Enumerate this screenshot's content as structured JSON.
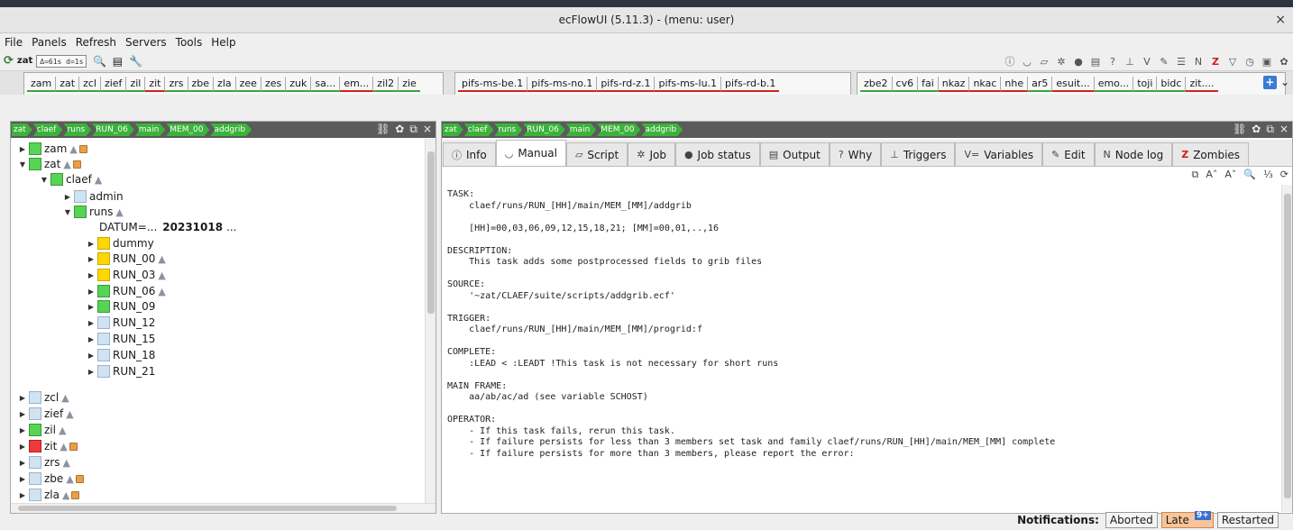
{
  "window": {
    "title": "ecFlowUI (5.11.3) - (menu: user)",
    "close": "×"
  },
  "menu": [
    "File",
    "Panels",
    "Refresh",
    "Servers",
    "Tools",
    "Help"
  ],
  "toolbar": {
    "server": "zat",
    "interval": "Δ=61s d=1s"
  },
  "server_tabs": {
    "group1": [
      {
        "label": "zam",
        "status": "green"
      },
      {
        "label": "zat",
        "status": "green"
      },
      {
        "label": "zcl",
        "status": "green"
      },
      {
        "label": "zief",
        "status": "green"
      },
      {
        "label": "zil",
        "status": "green"
      },
      {
        "label": "zit",
        "status": "red"
      },
      {
        "label": "zrs",
        "status": "green"
      },
      {
        "label": "zbe",
        "status": "green"
      },
      {
        "label": "zla",
        "status": "green"
      },
      {
        "label": "zee",
        "status": "green"
      },
      {
        "label": "zes",
        "status": "green"
      },
      {
        "label": "zuk",
        "status": "green"
      },
      {
        "label": "sa...",
        "status": "green"
      },
      {
        "label": "em...",
        "status": "red"
      },
      {
        "label": "zil2",
        "status": "green"
      },
      {
        "label": "zie",
        "status": "green"
      }
    ],
    "group2": [
      {
        "label": "pifs-ms-be.1",
        "status": "red"
      },
      {
        "label": "pifs-ms-no.1",
        "status": "red"
      },
      {
        "label": "pifs-rd-z.1",
        "status": "red"
      },
      {
        "label": "pifs-ms-lu.1",
        "status": "red"
      },
      {
        "label": "pifs-rd-b.1",
        "status": "red"
      }
    ],
    "group3": [
      {
        "label": "zbe2",
        "status": "green"
      },
      {
        "label": "cv6",
        "status": "green"
      },
      {
        "label": "fai",
        "status": "green"
      },
      {
        "label": "nkaz",
        "status": "red"
      },
      {
        "label": "nkac",
        "status": "red"
      },
      {
        "label": "nhe",
        "status": "red"
      },
      {
        "label": "ar5",
        "status": "green"
      },
      {
        "label": "esuit...",
        "status": "red"
      },
      {
        "label": "emo...",
        "status": "green"
      },
      {
        "label": "toji",
        "status": "green"
      },
      {
        "label": "bidc",
        "status": "green"
      },
      {
        "label": "zit....",
        "status": "red"
      }
    ]
  },
  "breadcrumb": [
    "zat",
    "claef",
    "runs",
    "RUN_06",
    "main",
    "MEM_00",
    "addgrib"
  ],
  "tree": {
    "zam": "zam",
    "zat": "zat",
    "claef": "claef",
    "admin": "admin",
    "runs": "runs",
    "datum_label": "DATUM=...",
    "datum_value": "20231018",
    "datum_more": "...",
    "dummy": "dummy",
    "run00": "RUN_00",
    "run03": "RUN_03",
    "run06": "RUN_06",
    "run09": "RUN_09",
    "run12": "RUN_12",
    "run15": "RUN_15",
    "run18": "RUN_18",
    "run21": "RUN_21",
    "zcl": "zcl",
    "zief": "zief",
    "zil": "zil",
    "zit": "zit",
    "zrs": "zrs",
    "zbe": "zbe",
    "zla": "zla"
  },
  "info_tabs": {
    "info": "Info",
    "manual": "Manual",
    "script": "Script",
    "job": "Job",
    "jobstatus": "Job status",
    "output": "Output",
    "why": "Why",
    "triggers": "Triggers",
    "variables": "Variables",
    "edit": "Edit",
    "nodelog": "Node log",
    "zombies": "Zombies"
  },
  "manual_lines": [
    "TASK:",
    "    claef/runs/RUN_[HH]/main/MEM_[MM]/addgrib",
    "",
    "    [HH]=00,03,06,09,12,15,18,21; [MM]=00,01,..,16",
    "",
    "DESCRIPTION:",
    "    This task adds some postprocessed fields to grib files",
    "",
    "SOURCE:",
    "    '~zat/CLAEF/suite/scripts/addgrib.ecf'",
    "",
    "TRIGGER:",
    "    claef/runs/RUN_[HH]/main/MEM_[MM]/progrid:f",
    "",
    "COMPLETE:",
    "    :LEAD < :LEADT !This task is not necessary for short runs",
    "",
    "MAIN FRAME:",
    "    aa/ab/ac/ad (see variable SCHOST)",
    "",
    "OPERATOR:",
    "    - If this task fails, rerun this task.",
    "    - If failure persists for less than 3 members set task and family claef/runs/RUN_[HH]/main/MEM_[MM] complete",
    "    - If failure persists for more than 3 members, please report the error:"
  ],
  "notifications": {
    "label": "Notifications:",
    "aborted": "Aborted",
    "late": "Late",
    "late_count": "9+",
    "restarted": "Restarted"
  }
}
